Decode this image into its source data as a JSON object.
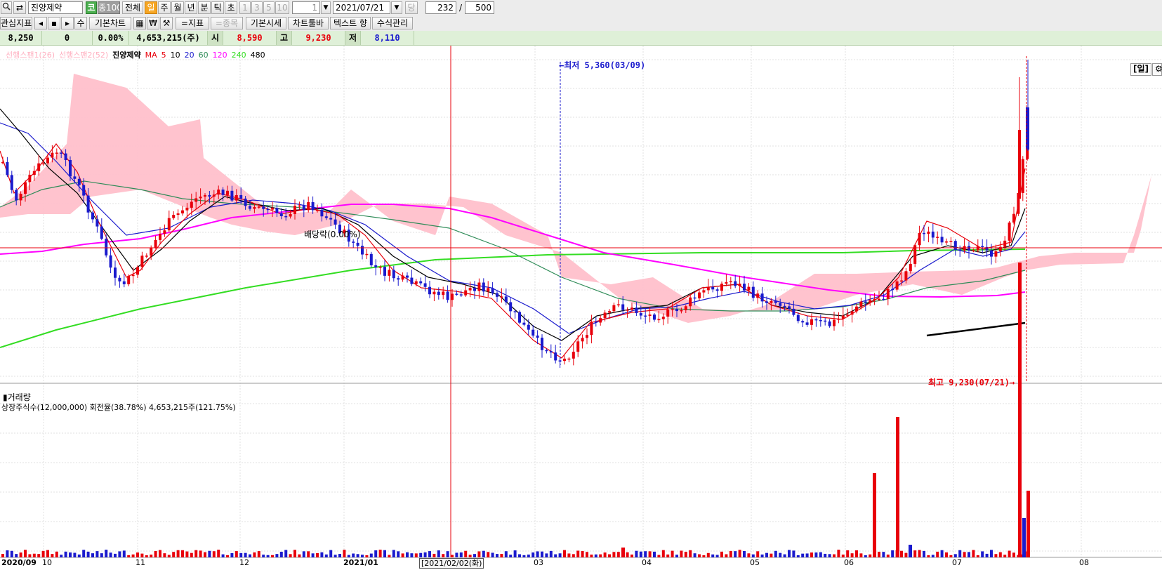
{
  "toolbar": {
    "stock_name": "진양제약",
    "market_badge": "코",
    "index_badge": "종100",
    "periods": [
      "전체",
      "일",
      "주",
      "월",
      "년",
      "분",
      "틱",
      "초"
    ],
    "selected_period": "일",
    "intervals": [
      "1",
      "3",
      "5",
      "10"
    ],
    "count_value": "1",
    "date_value": "2021/07/21",
    "dang_label": "당",
    "range_current": "232",
    "range_sep": "/",
    "range_total": "500"
  },
  "toolbar2": {
    "indicator_btn": "관심지표",
    "su_label": "수",
    "basic_chart": "기본차트",
    "currency_icon": "₩",
    "indicator_label": "=지표",
    "item_label": "=종목",
    "basic_quote": "기본시세",
    "chart_toolbar": "차트툴바",
    "text_label": "텍스트 향",
    "formula": "수식관리"
  },
  "quote": {
    "price": "8,250",
    "change": "0",
    "rate": "0.00%",
    "volume": "4,653,215(주)",
    "open_label": "시",
    "open": "8,590",
    "high_label": "고",
    "high": "9,230",
    "low_label": "저",
    "low": "8,110",
    "period_label": "[일]"
  },
  "legend": {
    "span1": "선행스팬1(26)",
    "span2": "선행스팬2(52)",
    "name": "진양제약",
    "ma_label": "MA",
    "ma": [
      "5",
      "10",
      "20",
      "60",
      "120",
      "240",
      "480"
    ]
  },
  "annotations": {
    "low": "←최저 5,360(03/09)",
    "high": "최고 9,230(07/21)→",
    "dividend": "배당락(0.00%)"
  },
  "volume_panel": {
    "title": "거래량",
    "info": "상장주식수(12,000,000) 회전율(38.78%) 4,653,215주(121.75%)"
  },
  "x_axis": {
    "labels": [
      "2020/09",
      "10",
      "11",
      "12",
      "2021/01",
      "03",
      "04",
      "05",
      "06",
      "07",
      "08"
    ],
    "cursor_label": "[2021/02/02(화)"
  },
  "colors": {
    "up": "#e8000b",
    "down": "#1a1acd",
    "cloud": "#ffc0cb",
    "ma5": "#e8000b",
    "ma10": "#000000",
    "ma20": "#1a1acd",
    "ma60": "#2e8b57",
    "ma120": "#ff00ff",
    "ma240": "#33dd22",
    "ma480": "#000000"
  },
  "chart_data": {
    "type": "candlestick",
    "series_ranges": {
      "price_ylim": [
        5200,
        9600
      ],
      "volume_max": 4653215
    },
    "annotated_points": [
      {
        "label": "low",
        "date": "2021/03/09",
        "value": 5360
      },
      {
        "label": "high",
        "date": "2021/07/21",
        "value": 9230
      }
    ],
    "current_price": 8250
  }
}
